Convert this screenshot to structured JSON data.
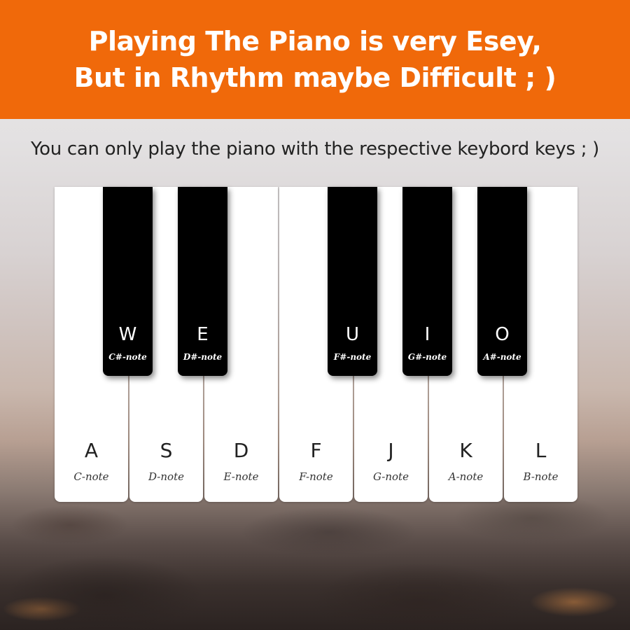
{
  "banner": {
    "line1": "Playing The Piano is very Esey,",
    "line2": "But in Rhythm maybe Difficult ; )",
    "color": "#f0690a"
  },
  "subtitle": "You can only play the piano with the respective keybord keys ; )",
  "white_keys": [
    {
      "letter": "A",
      "note": "C-note"
    },
    {
      "letter": "S",
      "note": "D-note"
    },
    {
      "letter": "D",
      "note": "E-note"
    },
    {
      "letter": "F",
      "note": "F-note"
    },
    {
      "letter": "J",
      "note": "G-note"
    },
    {
      "letter": "K",
      "note": "A-note"
    },
    {
      "letter": "L",
      "note": "B-note"
    }
  ],
  "black_keys": [
    {
      "letter": "W",
      "note": "C#-note"
    },
    {
      "letter": "E",
      "note": "D#-note"
    },
    {
      "letter": "U",
      "note": "F#-note"
    },
    {
      "letter": "I",
      "note": "G#-note"
    },
    {
      "letter": "O",
      "note": "A#-note"
    }
  ]
}
